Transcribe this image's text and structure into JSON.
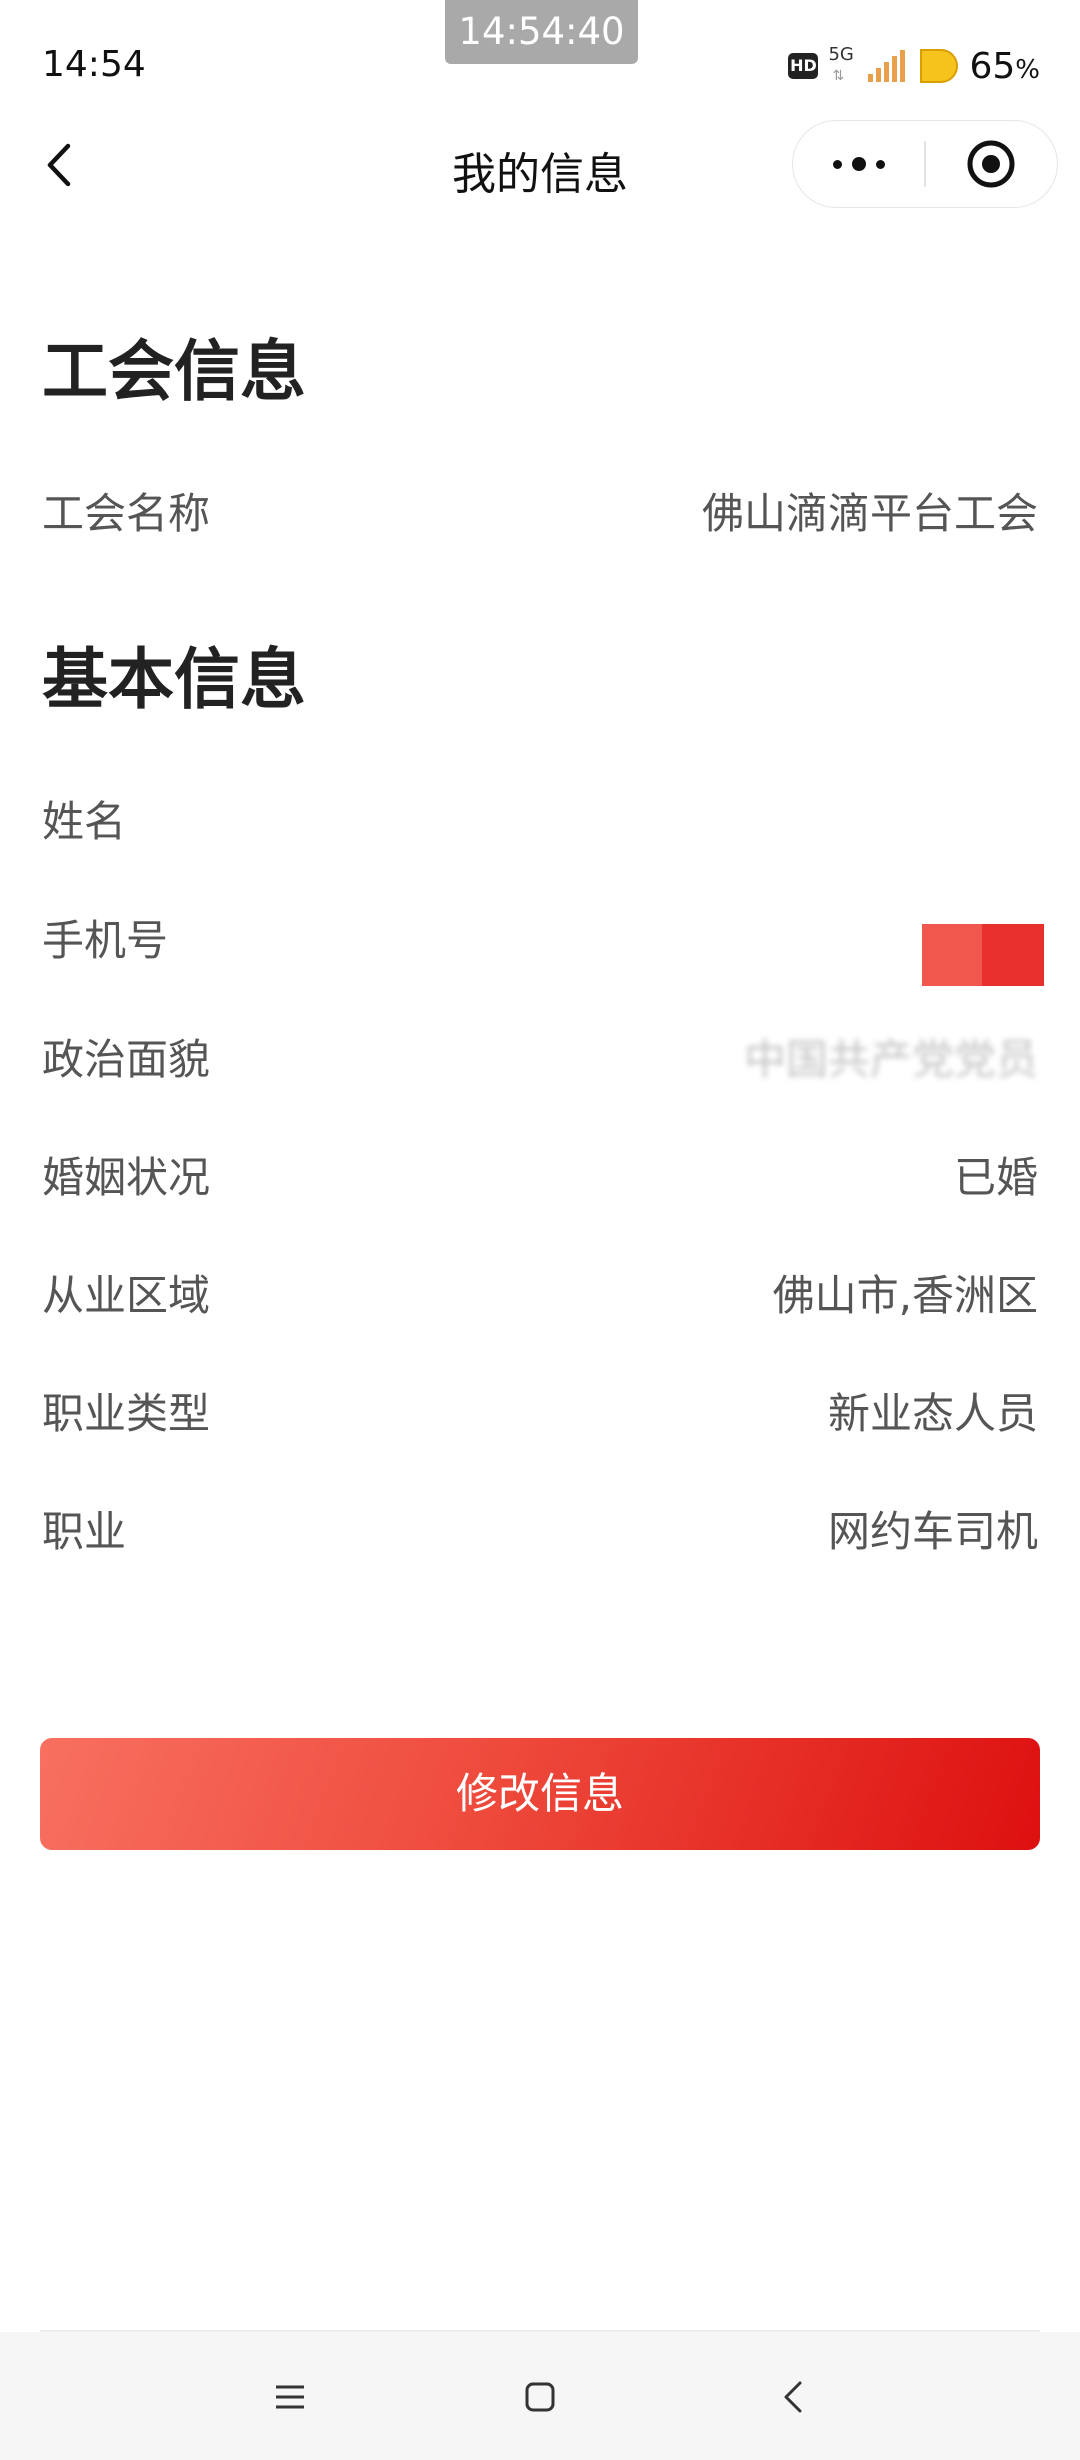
{
  "status_bar": {
    "time": "14:54",
    "overlay_time": "14:54:40",
    "hd_label": "HD",
    "network_label": "5G",
    "battery_value": "65",
    "battery_unit": "%",
    "signal_color": "#e8a04c",
    "battery_color": "#f6c21c"
  },
  "nav": {
    "title": "我的信息",
    "back_icon": "chevron-left-icon",
    "more_icon": "more-dots-icon",
    "close_icon": "target-circle-icon"
  },
  "union_section": {
    "title": "工会信息",
    "rows": [
      {
        "label": "工会名称",
        "value": "佛山滴滴平台工会"
      }
    ]
  },
  "basic_section": {
    "title": "基本信息",
    "rows": [
      {
        "label": "姓名",
        "value": ""
      },
      {
        "label": "手机号",
        "value": ""
      },
      {
        "label": "政治面貌",
        "value": "中国共产党党员"
      },
      {
        "label": "婚姻状况",
        "value": "已婚"
      },
      {
        "label": "从业区域",
        "value": "佛山市,香洲区"
      },
      {
        "label": "职业类型",
        "value": "新业态人员"
      },
      {
        "label": "职业",
        "value": "网约车司机"
      }
    ]
  },
  "redaction_colors": [
    "#f0584e",
    "#e8312c"
  ],
  "edit_button": {
    "label": "修改信息",
    "gradient_start": "#f87060",
    "gradient_end": "#dd1010"
  },
  "system_nav": {
    "menu_icon": "menu-lines-icon",
    "home_icon": "square-home-icon",
    "back_icon": "triangle-back-icon"
  }
}
